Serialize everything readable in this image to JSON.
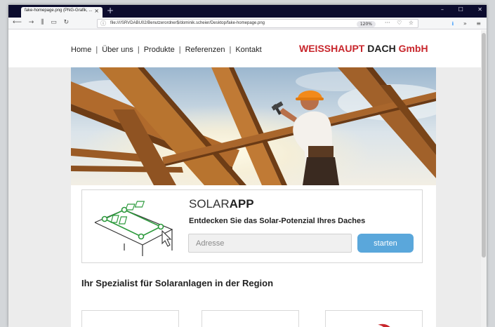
{
  "browser": {
    "tab_title": "fake-homepage.png (PNG-Grafik, ...",
    "tab_close": "×",
    "new_tab": "+",
    "url": "file:////SRVDABU02/Benutzerordner$/dominik.scheier/Desktop/fake-homepage.png",
    "zoom": "120%",
    "icons": [
      "back-icon",
      "forward-icon",
      "library-icon",
      "sidebar-icon",
      "reload-icon",
      "info-icon",
      "more-icon",
      "pocket-icon",
      "bookmark-star-icon",
      "download-icon",
      "overflow-icon",
      "menu-icon",
      "minimize-icon",
      "maximize-icon",
      "close-icon"
    ]
  },
  "header": {
    "nav": [
      "Home",
      "Über uns",
      "Produkte",
      "Referenzen",
      "Kontakt"
    ],
    "separator": "|",
    "brand_part1": "WEISSHAUPT",
    "brand_part2": "DACH",
    "brand_part3": "GmbH"
  },
  "solar": {
    "logo_light": "SOLAR",
    "logo_bold": "APP",
    "subtitle": "Entdecken Sie das Solar-Potenzial Ihres Daches",
    "address_placeholder": "Adresse",
    "button": "starten"
  },
  "tagline": "Ihr Spezialist für Solaranlagen in der Region",
  "colors": {
    "brand_red": "#c8262c",
    "button_blue": "#5aa7db",
    "icon_green": "#2c9a3c"
  }
}
